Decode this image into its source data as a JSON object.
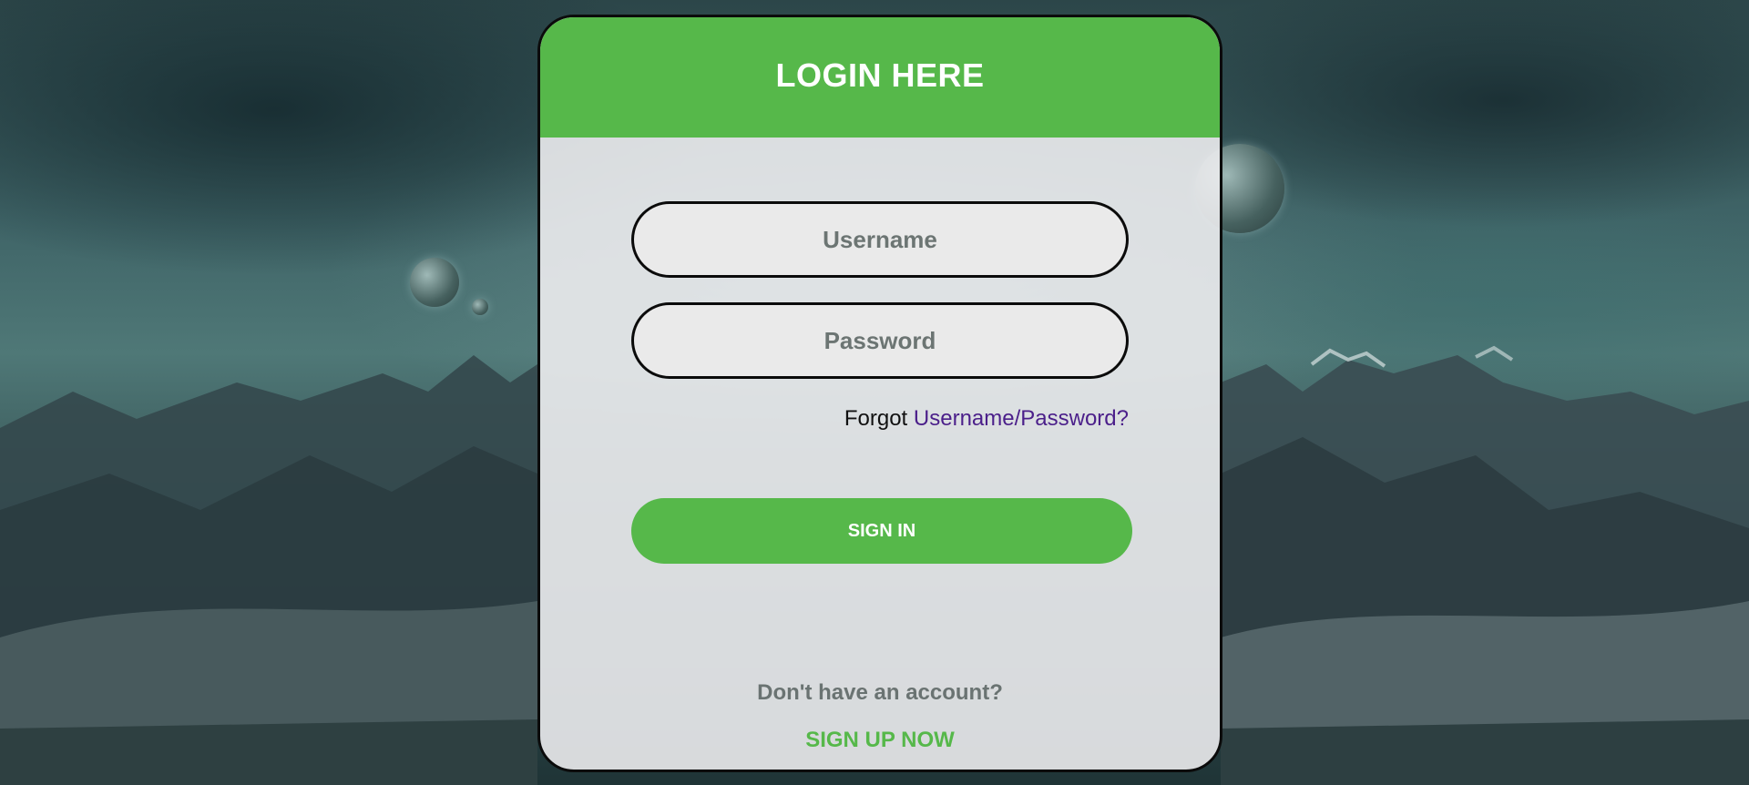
{
  "login": {
    "title": "LOGIN HERE",
    "username_placeholder": "Username",
    "password_placeholder": "Password",
    "forgot_prefix": "Forgot ",
    "forgot_link": "Username/Password?",
    "signin_label": "SIGN IN",
    "no_account_text": "Don't have an account?",
    "signup_label": "SIGN UP NOW"
  },
  "colors": {
    "accent_green": "#56b84a",
    "link_purple": "#4b1f8a",
    "muted_text": "#6a7372"
  }
}
